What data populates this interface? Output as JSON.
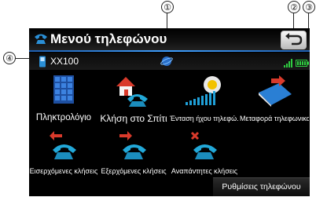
{
  "callouts": [
    "①",
    "②",
    "③",
    "④"
  ],
  "title": {
    "text": "Μενού τηλεφώνου"
  },
  "status": {
    "device_name": "XX100"
  },
  "tiles": [
    {
      "label": "Πληκτρολόγιο"
    },
    {
      "label": "Κλήση στο Σπίτι"
    },
    {
      "label": "Ένταση ήχου τηλεφώ..."
    },
    {
      "label": "Μεταφορά τηλεφωνικα..."
    },
    {
      "label": "Εισερχόμενες κλήσεις"
    },
    {
      "label": "Εξερχόμενες κλήσεις"
    },
    {
      "label": "Αναπάντητες κλήσεις"
    }
  ],
  "settings": {
    "label": "Ρυθμίσεις τηλεφώνου"
  },
  "colors": {
    "accent": "#2a8fd6",
    "battery": "#2ecc40",
    "signal": "#2ecc40"
  }
}
